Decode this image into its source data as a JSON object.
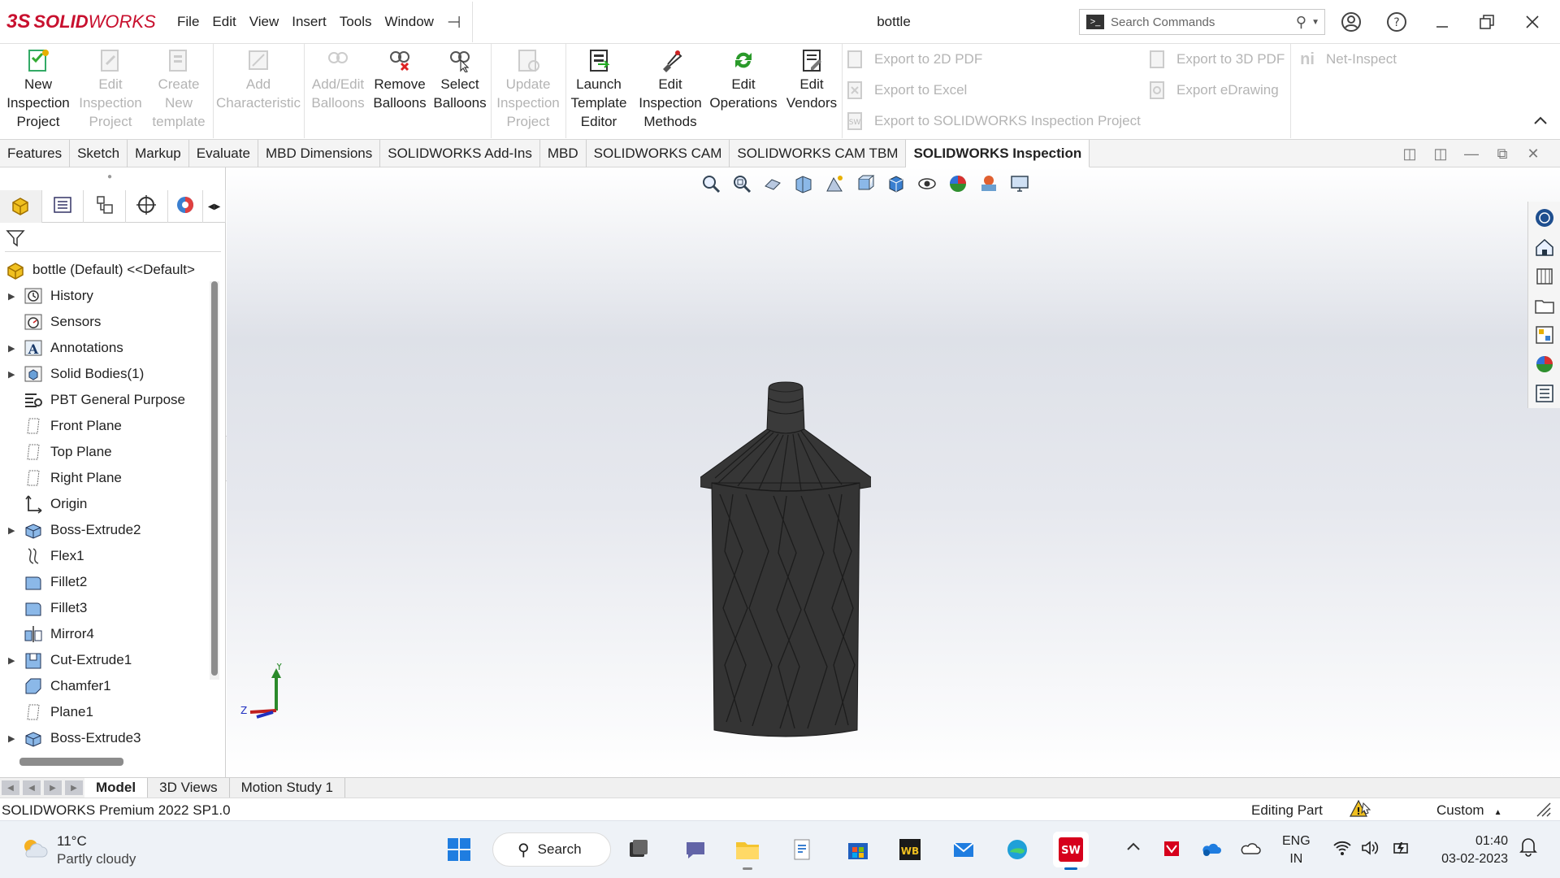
{
  "app": {
    "logo_ds": "3S",
    "logo_solid": "SOLID",
    "logo_works": "WORKS",
    "menus": [
      "File",
      "Edit",
      "View",
      "Insert",
      "Tools",
      "Window"
    ],
    "document_title": "bottle",
    "search_placeholder": "Search Commands"
  },
  "ribbon": {
    "buttons": [
      {
        "label": "New Inspection Project",
        "l1": "New",
        "l2": "Inspection",
        "l3": "Project",
        "enabled": true,
        "icon": "new-inspection-icon"
      },
      {
        "label": "Edit Inspection Project",
        "l1": "Edit",
        "l2": "Inspection",
        "l3": "Project",
        "enabled": false,
        "icon": "edit-inspection-icon"
      },
      {
        "label": "Create New template",
        "l1": "Create",
        "l2": "New",
        "l3": "template",
        "enabled": false,
        "icon": "create-template-icon"
      },
      {
        "label": "Add Characteristic",
        "l1": "Add",
        "l2": "Characteristic",
        "l3": "",
        "enabled": false,
        "icon": "add-characteristic-icon"
      },
      {
        "label": "Add/Edit Balloons",
        "l1": "Add/Edit",
        "l2": "Balloons",
        "l3": "",
        "enabled": false,
        "icon": "add-balloons-icon"
      },
      {
        "label": "Remove Balloons",
        "l1": "Remove",
        "l2": "Balloons",
        "l3": "",
        "enabled": true,
        "icon": "remove-balloons-icon"
      },
      {
        "label": "Select Balloons",
        "l1": "Select",
        "l2": "Balloons",
        "l3": "",
        "enabled": true,
        "icon": "select-balloons-icon"
      },
      {
        "label": "Update Inspection Project",
        "l1": "Update",
        "l2": "Inspection",
        "l3": "Project",
        "enabled": false,
        "icon": "update-inspection-icon"
      },
      {
        "label": "Launch Template Editor",
        "l1": "Launch",
        "l2": "Template",
        "l3": "Editor",
        "enabled": true,
        "icon": "template-editor-icon"
      },
      {
        "label": "Edit Inspection Methods",
        "l1": "Edit",
        "l2": "Inspection",
        "l3": "Methods",
        "enabled": true,
        "icon": "inspection-methods-icon"
      },
      {
        "label": "Edit Operations",
        "l1": "Edit",
        "l2": "Operations",
        "l3": "",
        "enabled": true,
        "icon": "operations-icon"
      },
      {
        "label": "Edit Vendors",
        "l1": "Edit",
        "l2": "Vendors",
        "l3": "",
        "enabled": true,
        "icon": "vendors-icon"
      }
    ],
    "exports_left": [
      "Export to 2D PDF",
      "Export to Excel",
      "Export to SOLIDWORKS Inspection Project"
    ],
    "exports_right": [
      "Export to 3D PDF",
      "Export eDrawing"
    ],
    "net_inspect": "Net-Inspect"
  },
  "tabs": [
    "Features",
    "Sketch",
    "Markup",
    "Evaluate",
    "MBD Dimensions",
    "SOLIDWORKS Add-Ins",
    "MBD",
    "SOLIDWORKS CAM",
    "SOLIDWORKS CAM TBM",
    "SOLIDWORKS Inspection"
  ],
  "active_tab": "SOLIDWORKS Inspection",
  "tree": {
    "root": "bottle (Default) <<Default>",
    "items": [
      {
        "label": "History",
        "expandable": true,
        "icon": "history-icon"
      },
      {
        "label": "Sensors",
        "expandable": false,
        "icon": "sensors-icon"
      },
      {
        "label": "Annotations",
        "expandable": true,
        "icon": "annotations-icon"
      },
      {
        "label": "Solid Bodies(1)",
        "expandable": true,
        "icon": "solid-bodies-icon"
      },
      {
        "label": "PBT General Purpose",
        "expandable": false,
        "icon": "material-icon"
      },
      {
        "label": "Front Plane",
        "expandable": false,
        "icon": "plane-icon"
      },
      {
        "label": "Top Plane",
        "expandable": false,
        "icon": "plane-icon"
      },
      {
        "label": "Right Plane",
        "expandable": false,
        "icon": "plane-icon"
      },
      {
        "label": "Origin",
        "expandable": false,
        "icon": "origin-icon"
      },
      {
        "label": "Boss-Extrude2",
        "expandable": true,
        "icon": "extrude-icon"
      },
      {
        "label": "Flex1",
        "expandable": false,
        "icon": "flex-icon"
      },
      {
        "label": "Fillet2",
        "expandable": false,
        "icon": "fillet-icon"
      },
      {
        "label": "Fillet3",
        "expandable": false,
        "icon": "fillet-icon"
      },
      {
        "label": "Mirror4",
        "expandable": false,
        "icon": "mirror-icon"
      },
      {
        "label": "Cut-Extrude1",
        "expandable": true,
        "icon": "cut-extrude-icon"
      },
      {
        "label": "Chamfer1",
        "expandable": false,
        "icon": "chamfer-icon"
      },
      {
        "label": "Plane1",
        "expandable": false,
        "icon": "plane-icon"
      },
      {
        "label": "Boss-Extrude3",
        "expandable": true,
        "icon": "extrude-icon"
      }
    ]
  },
  "triad": {
    "y": "Y",
    "z": "Z"
  },
  "bottom_tabs": [
    "Model",
    "3D Views",
    "Motion Study 1"
  ],
  "active_bottom_tab": "Model",
  "status": {
    "version": "SOLIDWORKS Premium 2022 SP1.0",
    "mode": "Editing Part",
    "units": "Custom"
  },
  "taskbar": {
    "temperature": "11°C",
    "condition": "Partly cloudy",
    "search_label": "Search",
    "lang1": "ENG",
    "lang2": "IN",
    "time": "01:40",
    "date": "03-02-2023"
  },
  "colors": {
    "brand": "#c8102e",
    "disabled_text": "#b4b4b4",
    "bottle": "#333333",
    "taskbar": "#eef2f7"
  }
}
